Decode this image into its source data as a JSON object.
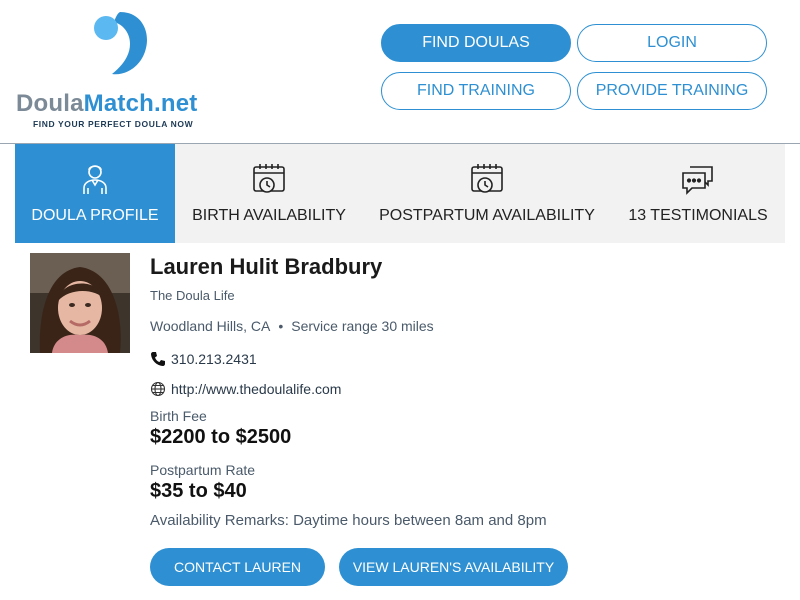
{
  "brand": {
    "name_part1": "Doula",
    "name_part2": "Match.net",
    "tagline": "FIND YOUR PERFECT DOULA NOW"
  },
  "nav": {
    "find_doulas": "FIND DOULAS",
    "login": "LOGIN",
    "find_training": "FIND TRAINING",
    "provide_training": "PROVIDE TRAINING"
  },
  "tabs": [
    {
      "label": "DOULA PROFILE",
      "icon": "doula-person-icon",
      "active": true
    },
    {
      "label": "BIRTH AVAILABILITY",
      "icon": "calendar-clock-icon",
      "active": false
    },
    {
      "label": "POSTPARTUM AVAILABILITY",
      "icon": "calendar-clock-icon",
      "active": false
    },
    {
      "label": "13 TESTIMONIALS",
      "icon": "chat-bubbles-icon",
      "active": false
    }
  ],
  "profile": {
    "name": "Lauren Hulit Bradbury",
    "business": "The Doula Life",
    "city": "Woodland Hills, CA",
    "service_range": "Service range 30 miles",
    "phone": "310.213.2431",
    "website": "http://www.thedoulalife.com",
    "birth_fee_label": "Birth Fee",
    "birth_fee": "$2200 to $2500",
    "postpartum_label": "Postpartum Rate",
    "postpartum_rate": "$35 to $40",
    "remarks": "Availability Remarks: Daytime hours between 8am and 8pm"
  },
  "actions": {
    "contact": "CONTACT LAUREN",
    "availability": "VIEW LAUREN'S AVAILABILITY"
  },
  "colors": {
    "accent": "#2e90d2",
    "tab_bg": "#f2f2f2"
  }
}
